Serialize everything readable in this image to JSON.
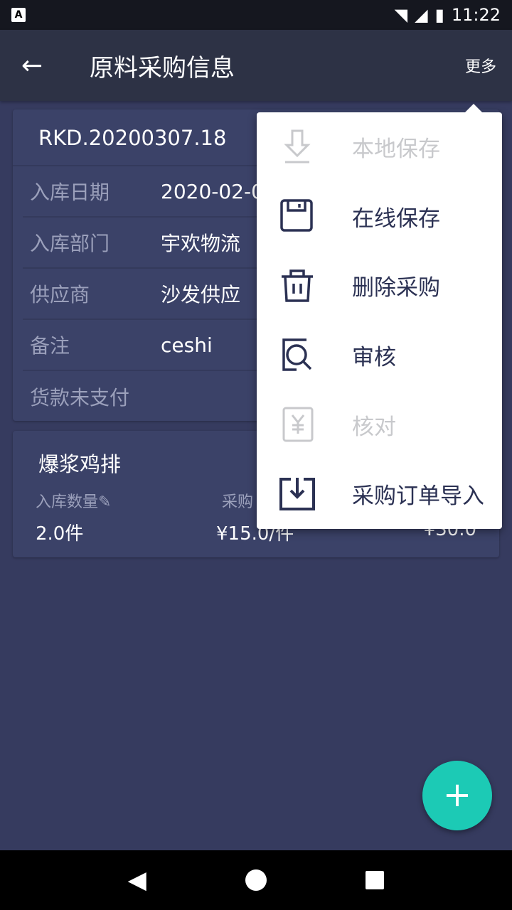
{
  "status_bar": {
    "time": "11:22",
    "notification_icon": "A"
  },
  "app_bar": {
    "title": "原料采购信息",
    "more_label": "更多"
  },
  "order": {
    "number": "RKD.20200307.18",
    "fields": [
      {
        "label": "入库日期",
        "value": "2020-02-0"
      },
      {
        "label": "入库部门",
        "value": "宇欢物流"
      },
      {
        "label": "供应商",
        "value": "沙发供应"
      },
      {
        "label": "备注",
        "value": "ceshi"
      },
      {
        "label": "货款未支付",
        "value": ""
      }
    ]
  },
  "item": {
    "name": "爆浆鸡排",
    "qty_label": "入库数量",
    "price_label": "采购",
    "qty": "2.0件",
    "price": "¥15.0/件",
    "total": "¥30.0"
  },
  "menu": [
    {
      "label": "本地保存",
      "icon": "download-icon",
      "enabled": false
    },
    {
      "label": "在线保存",
      "icon": "floppy-save-icon",
      "enabled": true
    },
    {
      "label": "删除采购",
      "icon": "trash-icon",
      "enabled": true
    },
    {
      "label": "审核",
      "icon": "search-audit-icon",
      "enabled": true
    },
    {
      "label": "核对",
      "icon": "yen-receipt-icon",
      "enabled": false
    },
    {
      "label": "采购订单导入",
      "icon": "import-icon",
      "enabled": true
    }
  ],
  "colors": {
    "accent": "#1ccab5",
    "background": "#363b5f",
    "card": "#3b4268",
    "app_bar": "#2d3245"
  }
}
